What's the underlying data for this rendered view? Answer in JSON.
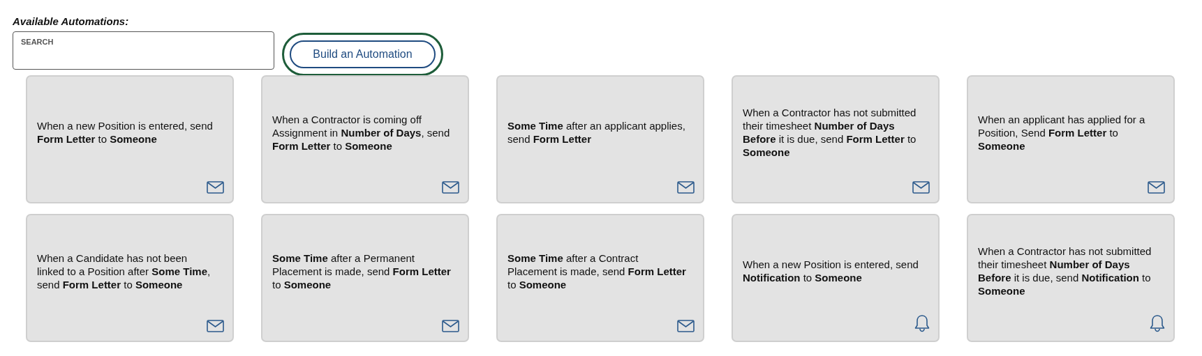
{
  "heading": "Available Automations:",
  "search": {
    "placeholder": "SEARCH"
  },
  "build_button": {
    "label": "Build an Automation",
    "focused": true
  },
  "automations": [
    {
      "text": "When a new Position is entered, send **Form Letter** to **Someone**",
      "kind": "email"
    },
    {
      "text": "When a Contractor is coming off Assignment in **Number of Days**, send **Form Letter** to **Someone**",
      "kind": "email"
    },
    {
      "text": "**Some Time** after an applicant applies, send **Form Letter**",
      "kind": "email"
    },
    {
      "text": "When a Contractor has not submitted their timesheet **Number of Days Before** it is due, send **Form Letter** to **Someone**",
      "kind": "email"
    },
    {
      "text": "When an applicant has applied for a Position, Send **Form Letter** to **Someone**",
      "kind": "email"
    },
    {
      "text": "When a Candidate has not been linked to a Position after **Some Time**, send **Form Letter** to **Someone**",
      "kind": "email"
    },
    {
      "text": "**Some Time** after a Permanent Placement is made, send **Form Letter** to **Someone**",
      "kind": "email"
    },
    {
      "text": "**Some Time** after a Contract Placement is made, send **Form Letter** to **Someone**",
      "kind": "email"
    },
    {
      "text": "When a new Position is entered, send **Notification** to **Someone**",
      "kind": "notification"
    },
    {
      "text": "When a Contractor has not submitted their timesheet **Number of Days Before** it is due, send **Notification** to **Someone**",
      "kind": "notification"
    }
  ]
}
